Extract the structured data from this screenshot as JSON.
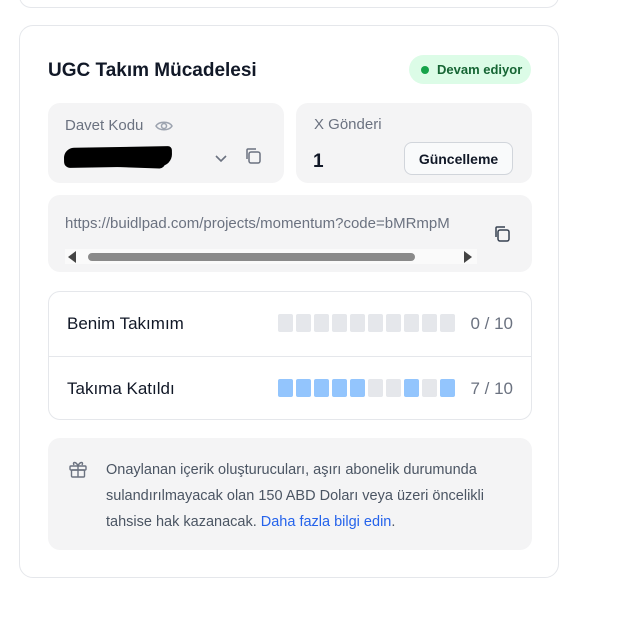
{
  "card": {
    "title": "UGC Takım Mücadelesi",
    "status": {
      "label": "Devam ediyor",
      "color": "#16a34a"
    }
  },
  "invite": {
    "label": "Davet Kodu",
    "icons": [
      "eye-icon",
      "chevron-down-icon",
      "copy-icon"
    ]
  },
  "x_posts": {
    "label": "X Gönderi",
    "count": "1",
    "update_button": "Güncelleme"
  },
  "share_link": {
    "url": "https://buidlpad.com/projects/momentum?code=bMRmpM"
  },
  "teams": [
    {
      "name": "Benim Takımım",
      "score": "0 / 10",
      "filled": 0,
      "segments": [
        0,
        0,
        0,
        0,
        0,
        0,
        0,
        0,
        0,
        0
      ]
    },
    {
      "name": "Takıma Katıldı",
      "score": "7 / 10",
      "filled": 7,
      "segments": [
        1,
        1,
        1,
        1,
        1,
        0,
        0,
        1,
        0,
        1
      ]
    }
  ],
  "info": {
    "text": "Onaylanan içerik oluşturucuları, aşırı abonelik durumunda sulandırılmayacak olan 150 ABD Doları veya üzeri öncelikli tahsise hak kazanacak.",
    "link_text": "Daha fazla bilgi edin",
    "suffix": "."
  },
  "colors": {
    "segment_on": "#93c5fd",
    "segment_off": "#e5e7eb",
    "link": "#2563eb"
  }
}
